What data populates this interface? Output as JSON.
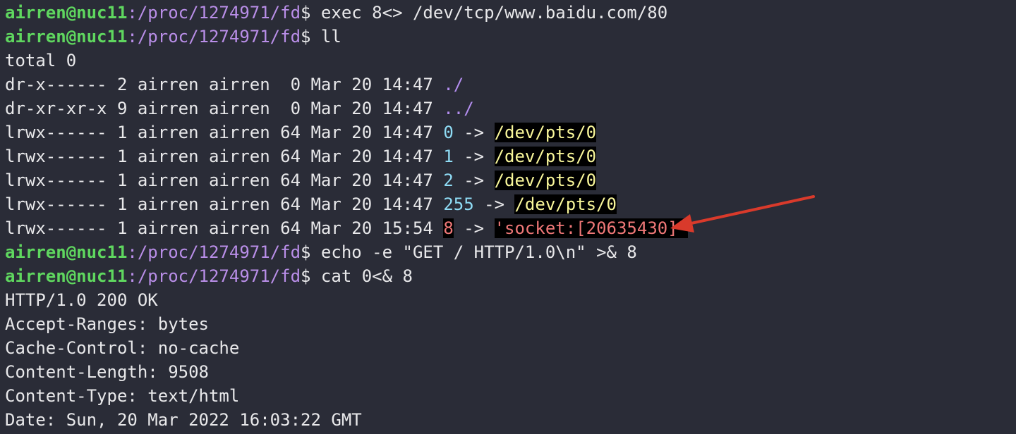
{
  "lines": [
    {
      "type": "prompt",
      "user": "airren@nuc11",
      "path": ":/proc/1274971/fd",
      "sym": "$",
      "cmd": " exec 8<> /dev/tcp/www.baidu.com/80"
    },
    {
      "type": "prompt",
      "user": "airren@nuc11",
      "path": ":/proc/1274971/fd",
      "sym": "$",
      "cmd": " ll"
    },
    {
      "type": "text",
      "text": "total 0"
    },
    {
      "type": "ls",
      "meta": "dr-x------ 2 airren airren  0 Mar 20 14:47 ",
      "name": "./"
    },
    {
      "type": "ls",
      "meta": "dr-xr-xr-x 9 airren airren  0 Mar 20 14:47 ",
      "name": "../"
    },
    {
      "type": "link",
      "meta": "lrwx------ 1 airren airren 64 Mar 20 14:47 ",
      "fd": "0",
      "arrow": " -> ",
      "target": "/dev/pts/0"
    },
    {
      "type": "link",
      "meta": "lrwx------ 1 airren airren 64 Mar 20 14:47 ",
      "fd": "1",
      "arrow": " -> ",
      "target": "/dev/pts/0"
    },
    {
      "type": "link",
      "meta": "lrwx------ 1 airren airren 64 Mar 20 14:47 ",
      "fd": "2",
      "arrow": " -> ",
      "target": "/dev/pts/0"
    },
    {
      "type": "link",
      "meta": "lrwx------ 1 airren airren 64 Mar 20 14:47 ",
      "fd": "255",
      "arrow": " -> ",
      "target": "/dev/pts/0"
    },
    {
      "type": "socket",
      "meta": "lrwx------ 1 airren airren 64 Mar 20 15:54 ",
      "fd": "8",
      "arrow": " -> ",
      "target": "'socket:[20635430]'"
    },
    {
      "type": "prompt",
      "user": "airren@nuc11",
      "path": ":/proc/1274971/fd",
      "sym": "$",
      "cmd": " echo -e \"GET / HTTP/1.0\\n\" >& 8"
    },
    {
      "type": "prompt",
      "user": "airren@nuc11",
      "path": ":/proc/1274971/fd",
      "sym": "$",
      "cmd": " cat 0<& 8"
    },
    {
      "type": "text",
      "text": "HTTP/1.0 200 OK"
    },
    {
      "type": "text",
      "text": "Accept-Ranges: bytes"
    },
    {
      "type": "text",
      "text": "Cache-Control: no-cache"
    },
    {
      "type": "text",
      "text": "Content-Length: 9508"
    },
    {
      "type": "text",
      "text": "Content-Type: text/html"
    },
    {
      "type": "text",
      "text": "Date: Sun, 20 Mar 2022 16:03:22 GMT"
    }
  ],
  "annotation": {
    "color": "#d93a2b"
  },
  "colors": {
    "background": "#2a2c37",
    "user": "#5fd75f",
    "path": "#b98ee8",
    "fd": "#8fdcf5",
    "target": "#f9f79a",
    "socket": "#f07878"
  }
}
